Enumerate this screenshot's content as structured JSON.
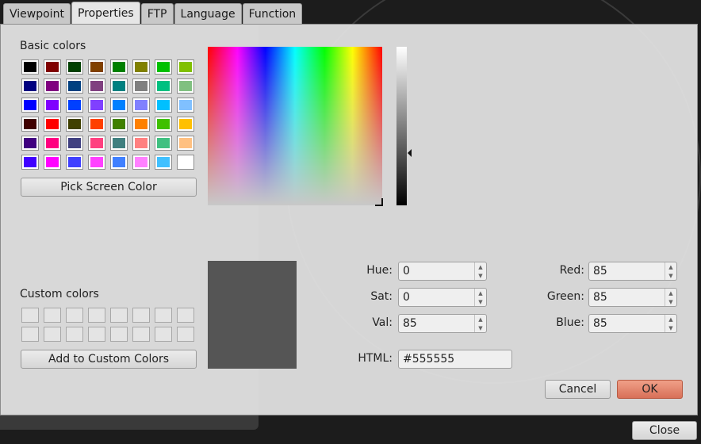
{
  "tabs": [
    {
      "label": "Viewpoint"
    },
    {
      "label": "Properties"
    },
    {
      "label": "FTP"
    },
    {
      "label": "Language"
    },
    {
      "label": "Function"
    }
  ],
  "dialog": {
    "basic_colors_label": "Basic colors",
    "basic_colors": [
      "#000000",
      "#800000",
      "#004000",
      "#804000",
      "#008000",
      "#808000",
      "#00c000",
      "#80c000",
      "#000080",
      "#800080",
      "#004080",
      "#804080",
      "#008080",
      "#808080",
      "#00c080",
      "#80c080",
      "#0000ff",
      "#8000ff",
      "#0040ff",
      "#8040ff",
      "#0080ff",
      "#8080ff",
      "#00c0ff",
      "#80c0ff",
      "#400000",
      "#ff0000",
      "#404000",
      "#ff4000",
      "#408000",
      "#ff8000",
      "#40c000",
      "#ffc000",
      "#400080",
      "#ff0080",
      "#404080",
      "#ff4080",
      "#408080",
      "#ff8080",
      "#40c080",
      "#ffc080",
      "#4000ff",
      "#ff00ff",
      "#4040ff",
      "#ff40ff",
      "#4080ff",
      "#ff80ff",
      "#40c0ff",
      "#ffffff"
    ],
    "pick_screen_color": "Pick Screen Color",
    "custom_colors_label": "Custom colors",
    "add_to_custom_colors": "Add to Custom Colors",
    "fields": {
      "hue_label": "Hue:",
      "hue": "0",
      "sat_label": "Sat:",
      "sat": "0",
      "val_label": "Val:",
      "val": "85",
      "red_label": "Red:",
      "red": "85",
      "green_label": "Green:",
      "green": "85",
      "blue_label": "Blue:",
      "blue": "85",
      "html_label": "HTML:",
      "html": "#555555"
    },
    "current_color": "#555555",
    "cancel": "Cancel",
    "ok": "OK"
  },
  "close_button": "Close"
}
